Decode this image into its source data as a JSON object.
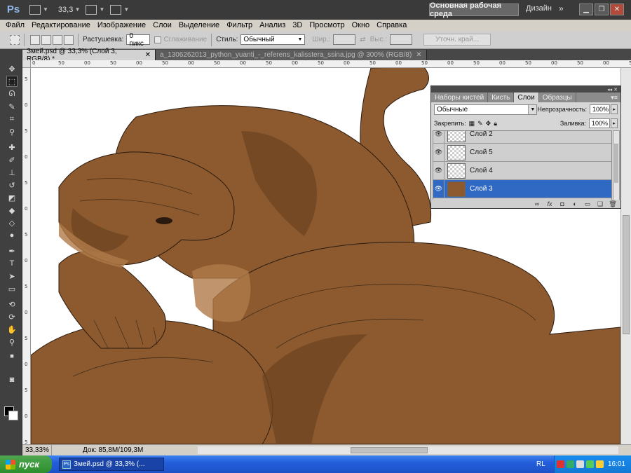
{
  "app": {
    "logo": "Ps",
    "zoom": "33,3",
    "workspace": "Основная рабочая среда",
    "design": "Дизайн",
    "more": "»"
  },
  "menu": [
    "Файл",
    "Редактирование",
    "Изображение",
    "Слои",
    "Выделение",
    "Фильтр",
    "Анализ",
    "3D",
    "Просмотр",
    "Окно",
    "Справка"
  ],
  "options": {
    "feather_label": "Растушевка:",
    "feather_value": "0 пикс",
    "antialias_label": "Сглаживание",
    "style_label": "Стиль:",
    "style_value": "Обычный",
    "width_label": "Шир.:",
    "height_label": "Выс.:",
    "refine_label": "Уточн. край..."
  },
  "tabs": {
    "active": "Змей.psd @ 33,3% (Слой 3, RGB/8) *",
    "inactive": "a_1306262013_python_yuanti_-_referens_kalisstera_ssina.jpg @ 300% (RGB/8)"
  },
  "rulers": {
    "top": [
      "0",
      "50",
      "00",
      "50",
      "00",
      "50",
      "00",
      "50",
      "00",
      "50",
      "00",
      "50",
      "00",
      "50",
      "00",
      "50",
      "00",
      "50",
      "00",
      "50",
      "00",
      "50",
      "00",
      "50"
    ],
    "left": [
      "5",
      "0",
      "5",
      "0",
      "5",
      "0",
      "5",
      "0",
      "5",
      "0",
      "5",
      "0",
      "5",
      "0",
      "5"
    ]
  },
  "status": {
    "zoom": "33,33%",
    "doc": "Док: 85,8M/109,3M"
  },
  "layers": {
    "tabs": [
      "Наборы кистей",
      "Кисть",
      "Слои",
      "Образцы"
    ],
    "active_tab": "Слои",
    "blend_mode": "Обычные",
    "opacity_label": "Непрозрачность:",
    "opacity_value": "100%",
    "lock_label": "Закрепить:",
    "fill_label": "Заливка:",
    "fill_value": "100%",
    "items": [
      {
        "name": "Слой 2",
        "selected": false
      },
      {
        "name": "Слой 5",
        "selected": false
      },
      {
        "name": "Слой 4",
        "selected": false
      },
      {
        "name": "Слой 3",
        "selected": true
      }
    ]
  },
  "taskbar": {
    "start": "пуск",
    "task": "Змей.psd @ 33,3% (...",
    "lang": "RL",
    "clock": "16:01"
  },
  "colors": {
    "snake_body": "#8c5a2e",
    "snake_shadow": "#6e4422",
    "snake_light": "#b07b48",
    "selection": "#2f69c4"
  }
}
